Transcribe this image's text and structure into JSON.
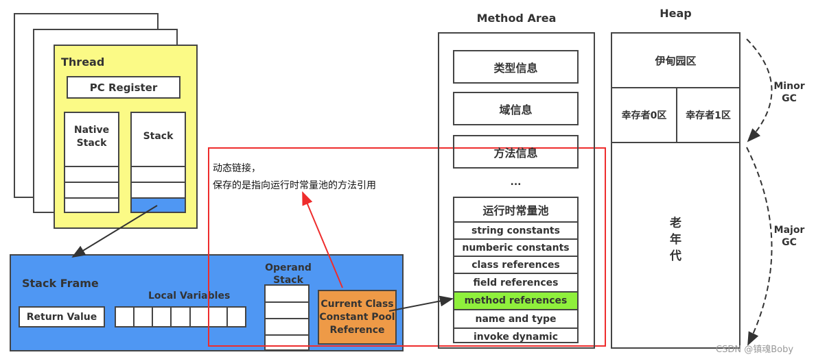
{
  "thread": {
    "title": "Thread",
    "pc_register": "PC Register",
    "native_stack": "Native\nStack",
    "stack": "Stack"
  },
  "stack_frame": {
    "title": "Stack Frame",
    "return_value": "Return Value",
    "local_variables": "Local Variables",
    "operand_stack": "Operand\nStack",
    "ccp_reference": "Current Class\nConstant Pool\nReference"
  },
  "annotation": {
    "line1": "动态链接，",
    "line2": "保存的是指向运行时常量池的方法引用"
  },
  "method_area": {
    "title": "Method Area",
    "items": [
      "类型信息",
      "域信息",
      "方法信息"
    ],
    "ellipsis": "...",
    "pool_title": "运行时常量池",
    "pool_rows": [
      "string constants",
      "numberic constants",
      "class references",
      "field references",
      "method references",
      "name and type",
      "invoke dynamic"
    ],
    "highlight_index": 4
  },
  "heap": {
    "title": "Heap",
    "eden": "伊甸园区",
    "survivor0": "幸存者0区",
    "survivor1": "幸存者1区",
    "old": "老\n年\n代",
    "minor_gc": "Minor\nGC",
    "major_gc": "Major\nGC"
  },
  "watermark": "CSDN @镇魂Boby",
  "colors": {
    "thread": "#fbfa86",
    "stack_frame": "#4f97f3",
    "ccp": "#ee9a47",
    "highlight": "#8ff03c",
    "red": "#ee2c2c"
  }
}
